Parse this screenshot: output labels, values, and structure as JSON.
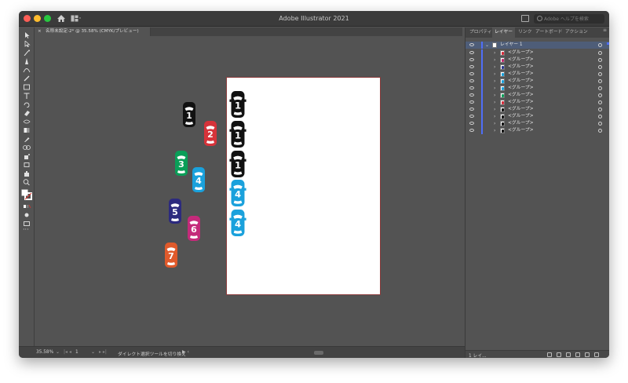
{
  "app": {
    "title": "Adobe Illustrator 2021"
  },
  "search": {
    "placeholder": "Adobe ヘルプを検索"
  },
  "document_tab": {
    "close": "×",
    "name": "名称未設定-2* @ 35.58% (CMYK/プレビュー)"
  },
  "panel": {
    "tabs": [
      "プロパティ",
      "レイヤー",
      "リンク",
      "アートボード",
      "アクション"
    ],
    "active_tab": "レイヤー",
    "layer_name": "レイヤー 1",
    "groups": [
      {
        "label": "<グループ>",
        "color": "#d62b3a"
      },
      {
        "label": "<グループ>",
        "color": "#c22a6e"
      },
      {
        "label": "<グループ>",
        "color": "#2c3a8f"
      },
      {
        "label": "<グループ>",
        "color": "#1aa1dc"
      },
      {
        "label": "<グループ>",
        "color": "#1aa1dc"
      },
      {
        "label": "<グループ>",
        "color": "#1aa1dc"
      },
      {
        "label": "<グループ>",
        "color": "#0a9e58"
      },
      {
        "label": "<グループ>",
        "color": "#d62b3a"
      },
      {
        "label": "<グループ>",
        "color": "#111111"
      },
      {
        "label": "<グループ>",
        "color": "#111111"
      },
      {
        "label": "<グループ>",
        "color": "#111111"
      },
      {
        "label": "<グループ>",
        "color": "#111111"
      }
    ],
    "layer_count": "1 レイ..."
  },
  "status": {
    "zoom": "35.58%",
    "page": "1",
    "tool": "ダイレクト選択ツールを切り換え"
  },
  "colors": {
    "car_black": "#111111",
    "car_red": "#d6333a",
    "car_green": "#0a9e58",
    "car_blue": "#1aa1dc",
    "car_navy": "#2c2a7e",
    "car_magenta": "#c42a7a",
    "car_orange": "#e05a2b",
    "layer_accent": "#4f6ef7"
  },
  "cars_loose": [
    {
      "number": "1",
      "color": "#111111"
    },
    {
      "number": "2",
      "color": "#d6333a"
    },
    {
      "number": "3",
      "color": "#0a9e58"
    },
    {
      "number": "4",
      "color": "#1aa1dc"
    },
    {
      "number": "5",
      "color": "#2c2a7e"
    },
    {
      "number": "6",
      "color": "#c42a7a"
    },
    {
      "number": "7",
      "color": "#e05a2b"
    }
  ],
  "cars_artboard": [
    {
      "number": "1",
      "color": "#111111"
    },
    {
      "number": "1",
      "color": "#111111"
    },
    {
      "number": "1",
      "color": "#111111"
    },
    {
      "number": "4",
      "color": "#1aa1dc"
    },
    {
      "number": "4",
      "color": "#1aa1dc"
    }
  ]
}
